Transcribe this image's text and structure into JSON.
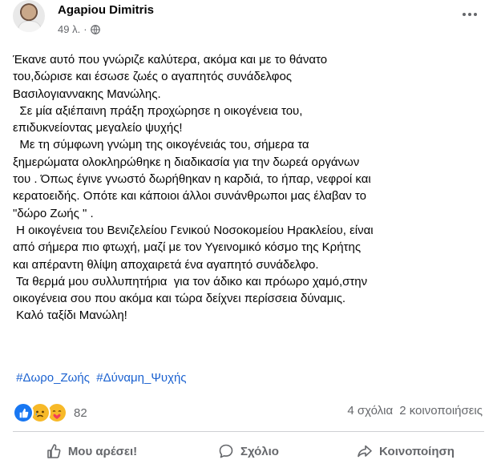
{
  "post": {
    "author": "Agapiou Dimitris",
    "time": "49 λ.",
    "separator": "·",
    "body_lines": [
      "Έκανε αυτό που γνώριζε καλύτερα, ακόμα και με το θάνατο",
      "του,δώρισε και έσωσε ζωές ο αγαπητός συνάδελφος",
      "Βασιλογιαννακης Μανώλης.",
      "  Σε μία αξιέπαινη πράξη προχώρησε η οικογένεια του,",
      "επιδυκνείοντας μεγαλείο ψυχής!",
      "  Με τη σύμφωνη γνώμη της οικογένειάς του, σήμερα τα",
      "ξημερώματα ολοκληρώθηκε η διαδικασία για την δωρεά οργάνων",
      "του . Όπως έγινε γνωστό δωρήθηκαν η καρδιά, το ήπαρ, νεφροί και",
      "κερατοειδής. Οπότε και κάποιοι άλλοι συνάνθρωποι μας έλαβαν το",
      "\"δώρο Ζωής \" .",
      " Η οικογένεια του Βενιζελείου Γενικού Νοσοκομείου Ηρακλείου, είναι",
      "από σήμερα πιο φτωχή, μαζί με τον Υγεινομικό κόσμο της Κρήτης",
      "και απέραντη θλίψη αποχαιρετά ένα αγαπητό συνάδελφο.",
      " Τα θερμά μου συλλυπητήρια  για τον άδικο και πρόωρο χαμό,στην",
      "οικογένεια σου που ακόμα και τώρα δείχνει περίσσεια δύναμις.",
      " Καλό ταξίδι Μανώλη!"
    ],
    "hashtags": [
      "#Δωρο_Ζωής",
      "#Δύναμη_Ψυχής"
    ]
  },
  "stats": {
    "reaction_count": "82",
    "comments": "4 σχόλια",
    "shares": "2 κοινοποιήσεις",
    "reaction_icons": [
      "like-icon",
      "sad-icon",
      "care-icon"
    ]
  },
  "actions": {
    "like": "Μου αρέσει!",
    "comment": "Σχόλιο",
    "share": "Κοινοποίηση"
  },
  "colors": {
    "link": "#1a61d0",
    "like_blue": "#1877f2",
    "emoji_yellow": "#f7b928",
    "muted": "#65676b"
  }
}
